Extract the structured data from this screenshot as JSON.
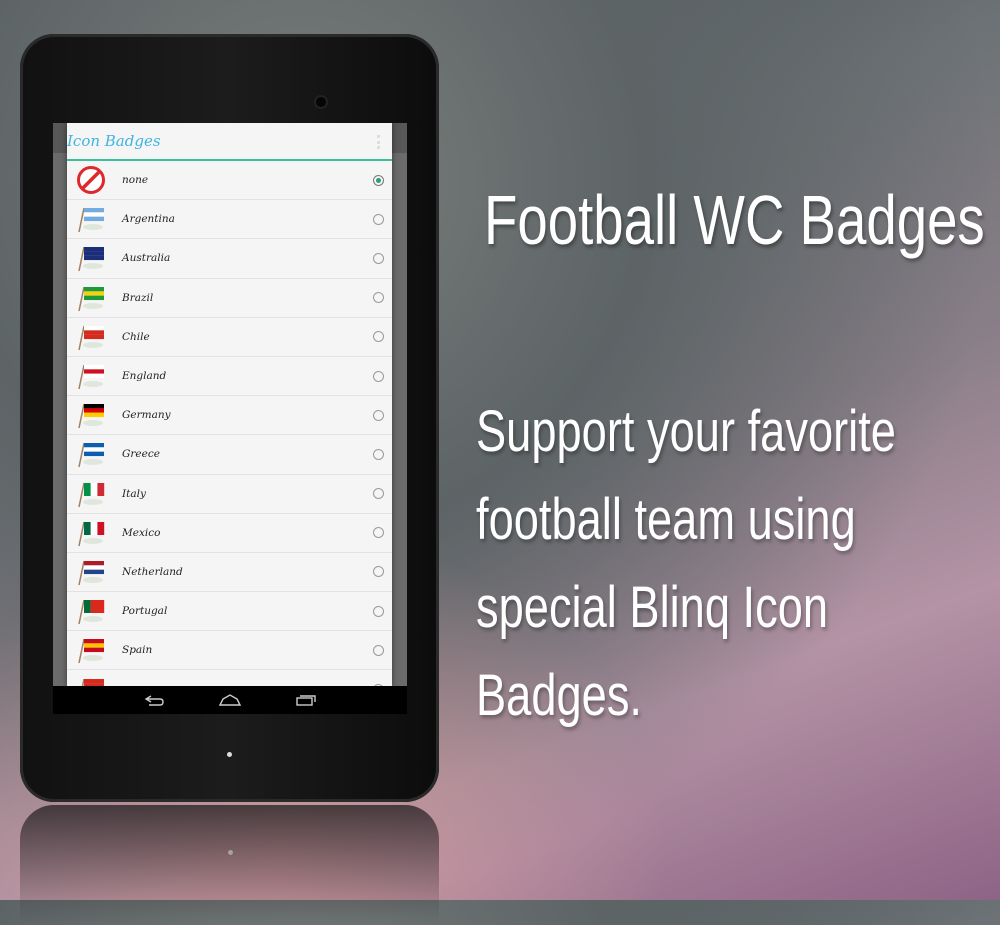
{
  "promo": {
    "headline": "Football WC Badges",
    "subtext": "Support your favorite football team using special Blinq Icon Badges."
  },
  "dialog": {
    "title": "Icon Badges",
    "accent": "#3cbf9c",
    "title_color": "#3eb5e0",
    "items": [
      {
        "label": "none",
        "icon": "no-entry-icon",
        "selected": true
      },
      {
        "label": "Argentina",
        "icon": "flag-argentina",
        "colors": [
          "#74acdf",
          "#ffffff",
          "#74acdf"
        ],
        "selected": false
      },
      {
        "label": "Australia",
        "icon": "flag-australia",
        "colors": [
          "#1c2e7a",
          "#1c2e7a",
          "#1c2e7a"
        ],
        "selected": false
      },
      {
        "label": "Brazil",
        "icon": "flag-brazil",
        "colors": [
          "#1e9a3c",
          "#f5d20f",
          "#1e9a3c"
        ],
        "selected": false
      },
      {
        "label": "Chile",
        "icon": "flag-chile",
        "colors": [
          "#ffffff",
          "#d52b1e",
          "#d52b1e"
        ],
        "selected": false
      },
      {
        "label": "England",
        "icon": "flag-england",
        "colors": [
          "#ffffff",
          "#ce1124",
          "#ffffff"
        ],
        "selected": false
      },
      {
        "label": "Germany",
        "icon": "flag-germany",
        "colors": [
          "#000000",
          "#dd0000",
          "#ffce00"
        ],
        "selected": false
      },
      {
        "label": "Greece",
        "icon": "flag-greece",
        "colors": [
          "#0d5eaf",
          "#ffffff",
          "#0d5eaf"
        ],
        "selected": false
      },
      {
        "label": "Italy",
        "icon": "flag-italy",
        "colors": [
          "#009246",
          "#ffffff",
          "#ce2b37"
        ],
        "vertical": true,
        "selected": false
      },
      {
        "label": "Mexico",
        "icon": "flag-mexico",
        "colors": [
          "#006847",
          "#ffffff",
          "#ce1126"
        ],
        "vertical": true,
        "selected": false
      },
      {
        "label": "Netherland",
        "icon": "flag-netherland",
        "colors": [
          "#ae1c28",
          "#ffffff",
          "#21468b"
        ],
        "selected": false
      },
      {
        "label": "Portugal",
        "icon": "flag-portugal",
        "colors": [
          "#046a38",
          "#da291c",
          "#da291c"
        ],
        "vertical": true,
        "selected": false
      },
      {
        "label": "Spain",
        "icon": "flag-spain",
        "colors": [
          "#c60b1e",
          "#ffc400",
          "#c60b1e"
        ],
        "selected": false
      },
      {
        "label": "",
        "icon": "flag-partial",
        "colors": [
          "#d52b1e",
          "#d52b1e",
          "#d52b1e"
        ],
        "selected": false
      }
    ]
  },
  "nav": {
    "back": "back-icon",
    "home": "home-icon",
    "recents": "recents-icon"
  }
}
